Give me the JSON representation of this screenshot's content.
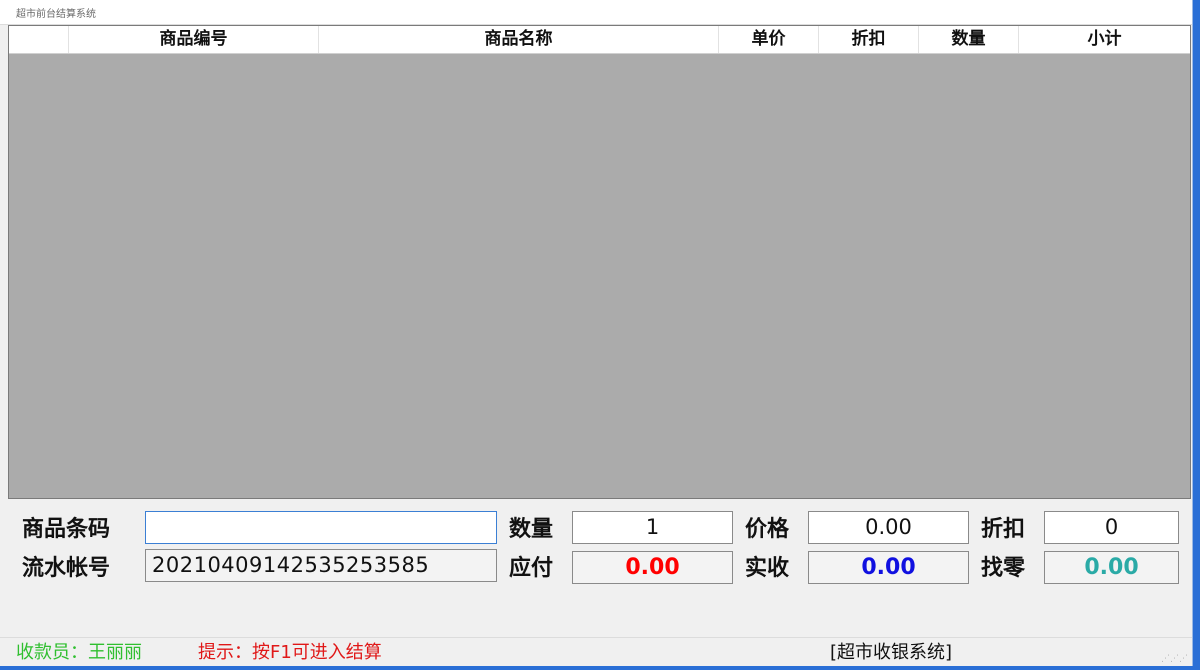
{
  "window": {
    "title": "超市前台结算系统"
  },
  "grid": {
    "columns": [
      "",
      "商品编号",
      "商品名称",
      "单价",
      "折扣",
      "数量",
      "小计"
    ]
  },
  "form": {
    "barcode": {
      "label": "商品条码",
      "value": "",
      "placeholder": ""
    },
    "serial": {
      "label": "流水帐号",
      "value": "20210409142535253585"
    },
    "quantity": {
      "label": "数量",
      "value": "1"
    },
    "price": {
      "label": "价格",
      "value": "0.00"
    },
    "discount": {
      "label": "折扣",
      "value": "0"
    },
    "payable": {
      "label": "应付",
      "value": "0.00",
      "color": "#ff0000"
    },
    "received": {
      "label": "实收",
      "value": "0.00",
      "color": "#1010e0"
    },
    "change": {
      "label": "找零",
      "value": "0.00",
      "color": "#2aaaa6"
    }
  },
  "status": {
    "cashier": "收款员：王丽丽",
    "hint": "提示：按F1可进入结算",
    "system": "[超市收银系统]"
  }
}
